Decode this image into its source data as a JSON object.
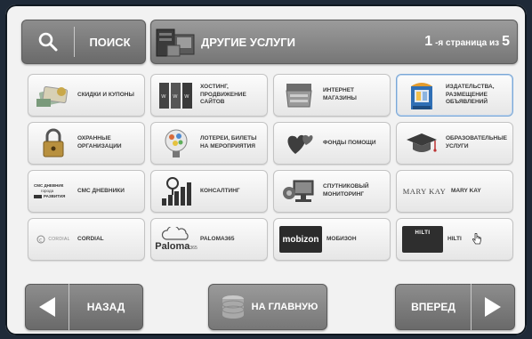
{
  "search": {
    "label": "ПОИСК",
    "icon": "search-icon"
  },
  "header": {
    "title": "ДРУГИЕ УСЛУГИ",
    "page_number": "1",
    "page_suffix": "-я страница из",
    "page_total": "5"
  },
  "tiles": [
    {
      "label": "СКИДКИ И КУПОНЫ",
      "icon": "coupons-icon"
    },
    {
      "label": "ХОСТИНГ,\nПРОДВИЖЕНИЕ\nСАЙТОВ",
      "icon": "servers-icon"
    },
    {
      "label": "ИНТЕРНЕТ\nМАГАЗИНЫ",
      "icon": "shop-icon"
    },
    {
      "label": "ИЗДАТЕЛЬСТВА,\nРАЗМЕЩЕНИЕ\nОБЪЯВЛЕНИЙ",
      "icon": "newspaper-kiosk-icon"
    },
    {
      "label": "ОХРАННЫЕ\nОРГАНИЗАЦИИ",
      "icon": "lock-icon"
    },
    {
      "label": "ЛОТЕРЕИ, БИЛЕТЫ\nНА МЕРОПРИЯТИЯ",
      "icon": "lottery-icon"
    },
    {
      "label": "ФОНДЫ ПОМОЩИ",
      "icon": "charity-hearts-icon"
    },
    {
      "label": "ОБРАЗОВАТЕЛЬНЫЕ\nУСЛУГИ",
      "icon": "graduation-cap-icon"
    },
    {
      "label": "СМС ДНЕВНИКИ",
      "icon": "sms-diary-logo",
      "logo_lines": [
        "СМС ДНЕВНИК",
        "города",
        "РАЗВИТИЯ"
      ]
    },
    {
      "label": "КОНСАЛТИНГ",
      "icon": "consulting-chart-icon"
    },
    {
      "label": "СПУТНИКОВЫЙ\nМОНИТОРИНГ",
      "icon": "satellite-monitoring-icon"
    },
    {
      "label": "MARY KAY",
      "icon": "mary-kay-logo",
      "logo_text": "MARY KAY"
    },
    {
      "label": "CORDIAL",
      "icon": "cordial-logo",
      "logo_text": "CORDIAL"
    },
    {
      "label": "PALOMA365",
      "icon": "paloma-logo",
      "logo_text": "Paloma",
      "logo_sub": "365"
    },
    {
      "label": "МОБИЗОН",
      "icon": "mobizon-logo",
      "logo_text": "mobizon"
    },
    {
      "label": "HILTI",
      "icon": "hilti-logo",
      "logo_text": "HILTI"
    }
  ],
  "nav": {
    "back": "НАЗАД",
    "home": "НА ГЛАВНУЮ",
    "next": "ВПЕРЕД"
  },
  "colors": {
    "button_gray": "#7a7a7a",
    "tile_bg": "#f4f4f4",
    "hilti_red": "#c8102e",
    "mobizon_dark": "#2b2b2b"
  }
}
